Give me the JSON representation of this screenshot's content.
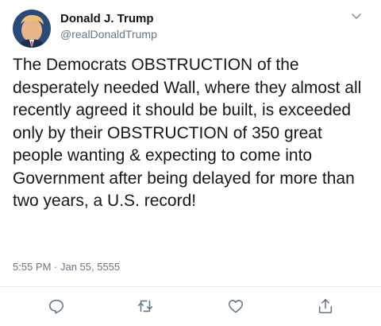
{
  "tweet": {
    "author": {
      "display_name": "Donald J. Trump",
      "handle": "@realDonaldTrump",
      "avatar": "profile-photo"
    },
    "text": "The Democrats OBSTRUCTION of the desperately needed Wall, where they almost all recently agreed it should be built, is exceeded only by their OBSTRUCTION of 350 great people wanting & expecting to come into Government after being delayed for more than two years, a U.S. record!",
    "timestamp": "5:55 PM · Jan 55, 5555"
  },
  "menu": {
    "icon": "chevron-down-icon"
  },
  "actions": [
    {
      "name": "reply",
      "icon": "reply-icon"
    },
    {
      "name": "retweet",
      "icon": "retweet-icon"
    },
    {
      "name": "like",
      "icon": "heart-icon"
    },
    {
      "name": "share",
      "icon": "share-icon"
    }
  ],
  "colors": {
    "text": "#14171a",
    "secondary": "#657786",
    "divider": "#e6ecf0",
    "icon": "#657786"
  }
}
